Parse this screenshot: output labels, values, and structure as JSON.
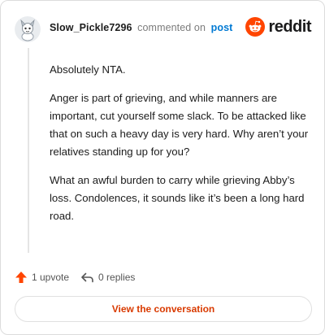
{
  "comment": {
    "author": "Slow_Pickle7296",
    "action_text": "commented on",
    "link_text": "post"
  },
  "brand": {
    "name": "reddit",
    "accent_color": "#ff4500"
  },
  "body_paragraphs": [
    "Absolutely NTA.",
    "Anger is part of grieving, and while manners are important, cut yourself some slack. To be attacked like that on such a heavy day is very hard. Why aren’t your relatives standing up for you?",
    "What an awful burden to carry while grieving Abby’s loss. Condolences, it sounds like it’s been a long hard road."
  ],
  "actions": {
    "upvote_icon": "upvote-arrow-icon",
    "upvote_label": "1 upvote",
    "reply_icon": "reply-arrow-icon",
    "reply_label": "0 replies"
  },
  "cta": {
    "label": "View the conversation"
  }
}
